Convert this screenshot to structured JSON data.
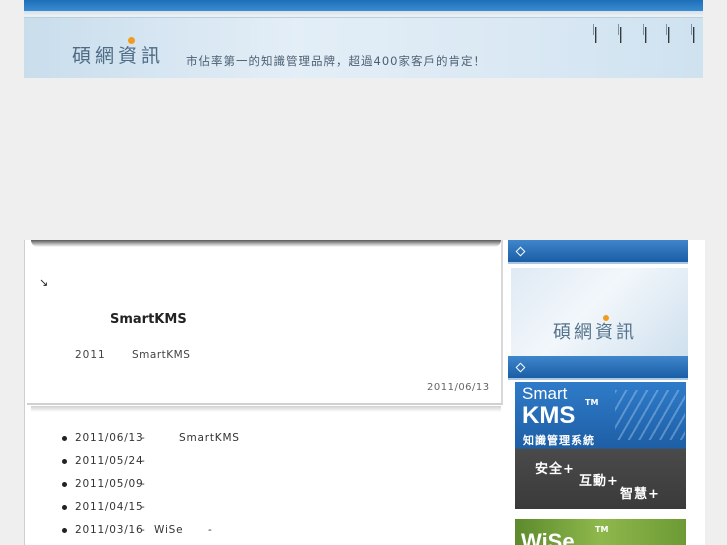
{
  "header": {
    "brand": "碩網資訊",
    "slogan": "市佔率第一的知識管理品牌，超過400家客戶的肯定！",
    "nav_separators": [
      "|",
      "|",
      "|",
      "|",
      "|"
    ]
  },
  "article": {
    "title": "SmartKMS",
    "year": "2011",
    "product": "SmartKMS",
    "date": "2011/06/13"
  },
  "news": [
    {
      "date": "2011/06/13",
      "dash": "-",
      "title": "SmartKMS"
    },
    {
      "date": "2011/05/24",
      "dash": "-",
      "title": ""
    },
    {
      "date": "2011/05/09",
      "dash": "-",
      "title": ""
    },
    {
      "date": "2011/04/15",
      "dash": "-",
      "title": ""
    },
    {
      "date": "2011/03/16",
      "dash": "-",
      "title": "WiSe",
      "dash2": "-"
    }
  ],
  "sidebar": {
    "logo_text": "碩網資訊",
    "kms_banner": {
      "smart": "Smart",
      "kms": "KMS",
      "tm": "TM",
      "subtitle": "知識管理系統",
      "tag1": "安全+",
      "tag2": "互動+",
      "tag3": "智慧+"
    },
    "wise_banner": {
      "text": "WiSe",
      "tm": "TM"
    }
  },
  "colors": {
    "top_bar": "#1d6fb8",
    "sidebar_header": "#2a72bb",
    "brand_dot": "#f29c1f"
  }
}
